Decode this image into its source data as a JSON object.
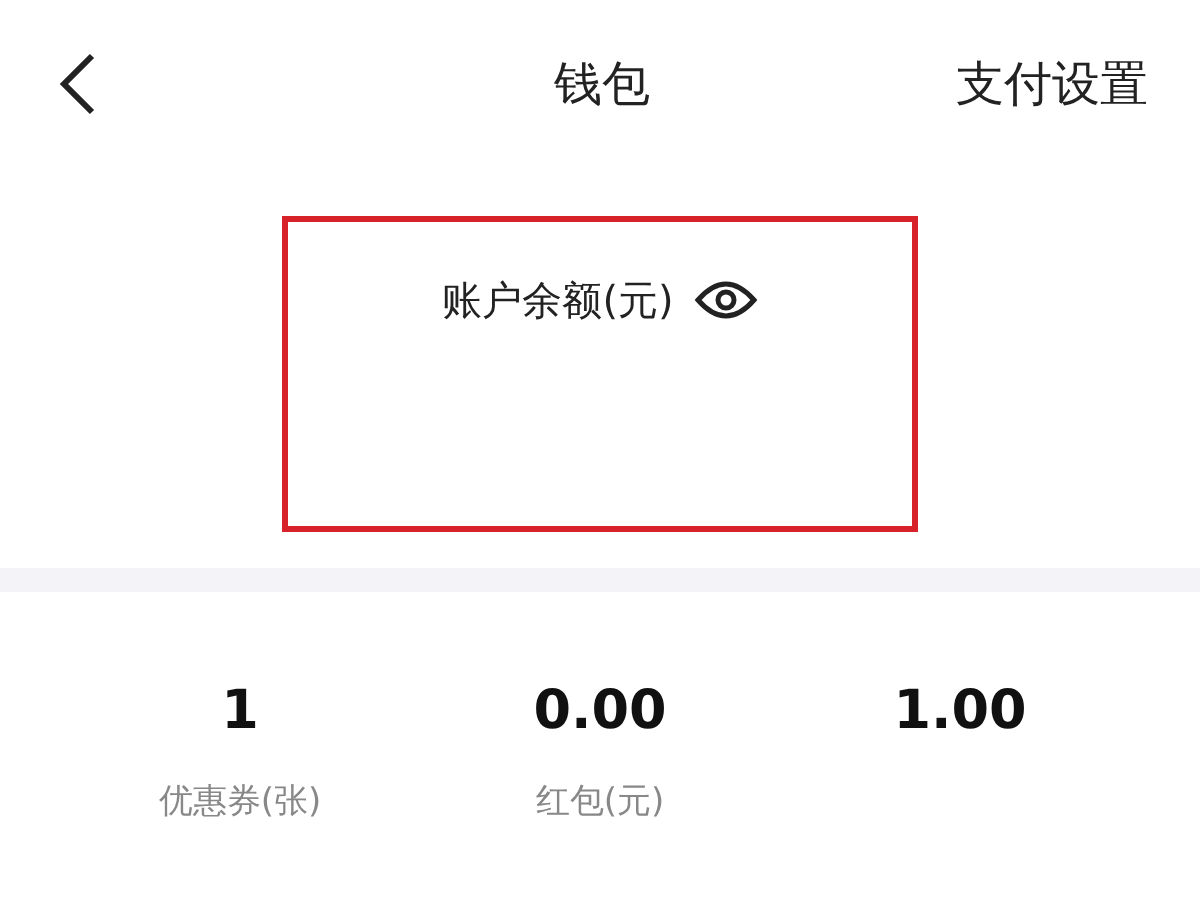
{
  "header": {
    "title": "钱包",
    "action": "支付设置"
  },
  "balance": {
    "label": "账户余额(元)",
    "highlighted": true
  },
  "stats": [
    {
      "value": "1",
      "label": "优惠券(张)"
    },
    {
      "value": "0.00",
      "label": "红包(元)"
    },
    {
      "value": "1.00"
    }
  ]
}
